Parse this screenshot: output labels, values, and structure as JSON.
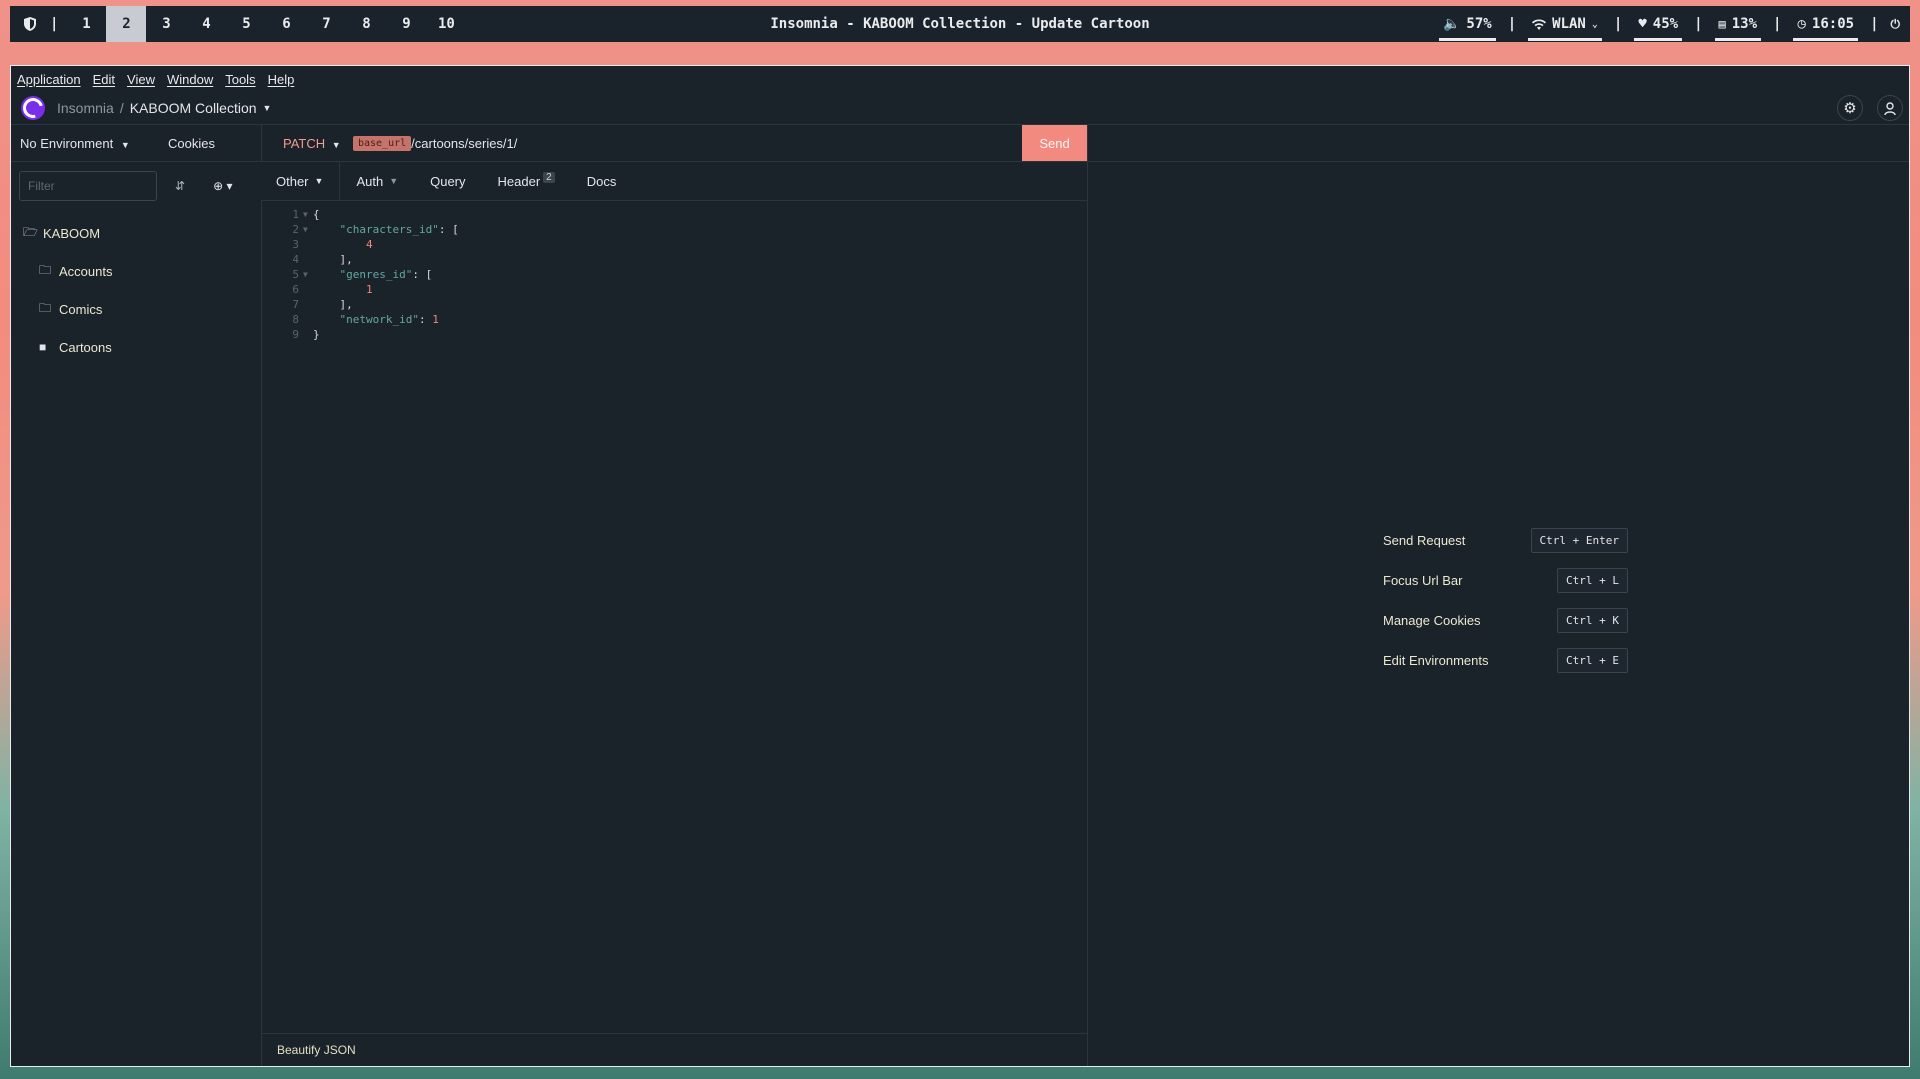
{
  "topbar": {
    "workspaces": [
      "1",
      "2",
      "3",
      "4",
      "5",
      "6",
      "7",
      "8",
      "9",
      "10"
    ],
    "active_workspace": "2",
    "pipe": "|",
    "title": "Insomnia - KABOOM Collection - Update Cartoon",
    "tray": {
      "volume": "57%",
      "wifi": "WLAN",
      "battery": "45%",
      "memory": "13%",
      "clock": "16:05"
    }
  },
  "menu": [
    "Application",
    "Edit",
    "View",
    "Window",
    "Tools",
    "Help"
  ],
  "header": {
    "crumb_root": "Insomnia",
    "crumb_sep": "/",
    "crumb_current": "KABOOM Collection"
  },
  "sidebar": {
    "environment": "No Environment",
    "cookies": "Cookies",
    "filter_placeholder": "Filter",
    "root": "KABOOM",
    "folders": [
      "Accounts",
      "Comics",
      "Cartoons"
    ]
  },
  "request": {
    "method": "PATCH",
    "url_var": "base_url",
    "url_path": "/cartoons/series/1/",
    "send_label": "Send",
    "tabs": {
      "body": "Other",
      "auth": "Auth",
      "query": "Query",
      "header": "Header",
      "header_count": "2",
      "docs": "Docs"
    },
    "body_lines": [
      "1",
      "2",
      "3",
      "4",
      "5",
      "6",
      "7",
      "8",
      "9"
    ],
    "json": {
      "k1": "\"characters_id\"",
      "v1": "4",
      "k2": "\"genres_id\"",
      "v2": "1",
      "k3": "\"network_id\"",
      "v3": "1"
    },
    "footer_action": "Beautify JSON"
  },
  "shortcuts": [
    {
      "label": "Send Request",
      "keys": "Ctrl + Enter"
    },
    {
      "label": "Focus Url Bar",
      "keys": "Ctrl + L"
    },
    {
      "label": "Manage Cookies",
      "keys": "Ctrl + K"
    },
    {
      "label": "Edit Environments",
      "keys": "Ctrl + E"
    }
  ],
  "colors": {
    "accent": "#f28a7f",
    "app_bg": "#1a222a",
    "logo": "#7a2eea",
    "json_key": "#63a7a2",
    "json_number": "#f1857a"
  }
}
